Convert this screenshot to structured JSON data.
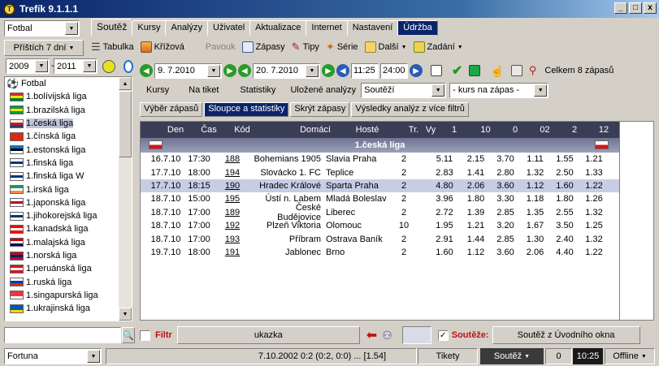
{
  "window": {
    "title": "Trefík 9.1.1.1",
    "minimize": "_",
    "maximize": "□",
    "close": "x"
  },
  "left": {
    "sport": "Fotbal",
    "period": "Příštích 7 dní",
    "year_from": "2009",
    "year_to": "2011",
    "search_value": "",
    "bookmaker": "Fortuna",
    "tree_root": "Fotbal",
    "leagues": [
      {
        "label": "1.bolívijská liga",
        "flag": [
          "#d52b1e",
          "#f9e300",
          "#007934"
        ]
      },
      {
        "label": "1.brazilská liga",
        "flag": [
          "#009c3b",
          "#ffdf00",
          "#009c3b"
        ]
      },
      {
        "label": "1.česká liga",
        "flag": [
          "#ffffff",
          "#d7141a",
          "#11457e"
        ],
        "selected": true
      },
      {
        "label": "1.čínská liga",
        "flag": [
          "#de2910",
          "#de2910",
          "#de2910"
        ]
      },
      {
        "label": "1.estonská liga",
        "flag": [
          "#0072ce",
          "#000000",
          "#ffffff"
        ]
      },
      {
        "label": "1.finská liga",
        "flag": [
          "#ffffff",
          "#003580",
          "#ffffff"
        ]
      },
      {
        "label": "1.finská liga W",
        "flag": [
          "#ffffff",
          "#003580",
          "#ffffff"
        ]
      },
      {
        "label": "1.irská liga",
        "flag": [
          "#169b62",
          "#ffffff",
          "#ff883e"
        ]
      },
      {
        "label": "1.japonská liga",
        "flag": [
          "#ffffff",
          "#bc002d",
          "#ffffff"
        ]
      },
      {
        "label": "1.jihokorejská liga",
        "flag": [
          "#ffffff",
          "#003478",
          "#ffffff"
        ]
      },
      {
        "label": "1.kanadská liga",
        "flag": [
          "#ff0000",
          "#ffffff",
          "#ff0000"
        ]
      },
      {
        "label": "1.malajská liga",
        "flag": [
          "#cc0001",
          "#ffffff",
          "#010066"
        ]
      },
      {
        "label": "1.norská liga",
        "flag": [
          "#ba0c2f",
          "#00205b",
          "#ba0c2f"
        ]
      },
      {
        "label": "1.peruánská liga",
        "flag": [
          "#d91023",
          "#ffffff",
          "#d91023"
        ]
      },
      {
        "label": "1.ruská liga",
        "flag": [
          "#ffffff",
          "#0039a6",
          "#d52b1e"
        ]
      },
      {
        "label": "1.singapurská liga",
        "flag": [
          "#ef3340",
          "#ef3340",
          "#ffffff"
        ]
      },
      {
        "label": "1.ukrajinská liga",
        "flag": [
          "#0057b7",
          "#0057b7",
          "#ffd700"
        ]
      }
    ]
  },
  "menu_tabs": [
    "Soutěž",
    "Kursy",
    "Analýzy",
    "Uživatel",
    "Aktualizace",
    "Internet",
    "Nastavení",
    "Údržba"
  ],
  "toolbar": {
    "tabulka": "Tabulka",
    "krizova": "Křížová",
    "pavouk": "Pavouk",
    "zapasy": "Zápasy",
    "tipy": "Tipy",
    "serie": "Série",
    "dalsi": "Další",
    "zadani": "Zadání"
  },
  "filter": {
    "date_from": "9. 7.2010",
    "date_to": "20. 7.2010",
    "time_from": "11:25",
    "time_to": "24:00",
    "total": "Celkem 8 zápasů"
  },
  "subnav": {
    "kursy": "Kursy",
    "na_tiket": "Na tiket",
    "statistiky": "Statistiky",
    "ulozene": "Uložené analýzy",
    "soutezi": "Soutěží",
    "kurs_na_zapas": "- kurs na zápas -"
  },
  "subtabs": [
    "Výběr zápasů",
    "Sloupce a statistiky",
    "Skrýt zápasy",
    "Výsledky analýz z více filtrů"
  ],
  "grid": {
    "headers": [
      "Den",
      "Čas",
      "Kód",
      "Domácí",
      "Hosté",
      "Tr.",
      "Vy",
      "1",
      "10",
      "0",
      "02",
      "2",
      "12",
      "+"
    ],
    "group": "1.česká liga",
    "rows": [
      [
        "16.7.10",
        "17:30",
        "188",
        "Bohemians 1905",
        "Slavia Praha",
        "2",
        "",
        "5.11",
        "2.15",
        "3.70",
        "1.11",
        "1.55",
        "1.21"
      ],
      [
        "17.7.10",
        "18:00",
        "194",
        "Slovácko 1. FC",
        "Teplice",
        "2",
        "",
        "2.83",
        "1.41",
        "2.80",
        "1.32",
        "2.50",
        "1.33"
      ],
      [
        "17.7.10",
        "18:15",
        "190",
        "Hradec Králové",
        "Sparta Praha",
        "2",
        "",
        "4.80",
        "2.06",
        "3.60",
        "1.12",
        "1.60",
        "1.22"
      ],
      [
        "18.7.10",
        "15:00",
        "195",
        "Ústí n. Labem",
        "Mladá Boleslav",
        "2",
        "",
        "3.96",
        "1.80",
        "3.30",
        "1.18",
        "1.80",
        "1.26"
      ],
      [
        "18.7.10",
        "17:00",
        "189",
        "České Budějovice",
        "Liberec",
        "2",
        "",
        "2.72",
        "1.39",
        "2.85",
        "1.35",
        "2.55",
        "1.32"
      ],
      [
        "18.7.10",
        "17:00",
        "192",
        "Plzeň Viktoria",
        "Olomouc",
        "10",
        "",
        "1.95",
        "1.21",
        "3.20",
        "1.67",
        "3.50",
        "1.25"
      ],
      [
        "18.7.10",
        "17:00",
        "193",
        "Příbram",
        "Ostrava Baník",
        "2",
        "",
        "2.91",
        "1.44",
        "2.85",
        "1.30",
        "2.40",
        "1.32"
      ],
      [
        "19.7.10",
        "18:00",
        "191",
        "Jablonec",
        "Brno",
        "2",
        "",
        "1.60",
        "1.12",
        "3.60",
        "2.06",
        "4.40",
        "1.22"
      ]
    ]
  },
  "bottom": {
    "filtr": "Filtr",
    "ukazka": "ukazka",
    "souteze": "Soutěže:",
    "soutez_uvod": "Soutěž z Úvodního okna"
  },
  "statusbar": {
    "info": "7.10.2002 0:2 (0:2, 0:0) ... [1.54]",
    "tikety": "Tikety",
    "soutez": "Soutěž",
    "count": "0",
    "time": "10:25",
    "mode": "Offline"
  }
}
